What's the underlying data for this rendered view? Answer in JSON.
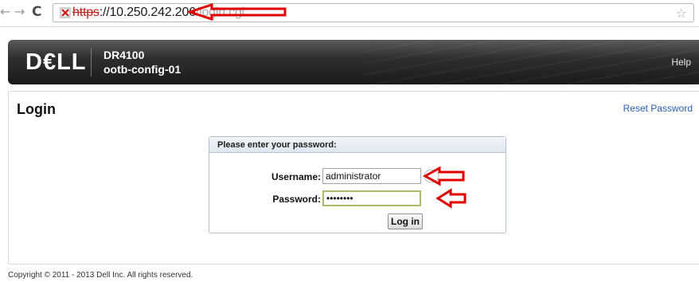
{
  "browser": {
    "url_scheme": "https",
    "url_host": "://10.250.242.206",
    "url_path": "/login.cgi",
    "icons": {
      "back": "arrow-left-icon",
      "forward": "arrow-right-icon",
      "reload": "reload-icon",
      "security": "broken-lock-icon",
      "bookmark": "star-icon"
    }
  },
  "header": {
    "logo": "D€LL",
    "product": "DR4100",
    "host": "ootb-config-01",
    "help": "Help"
  },
  "page": {
    "title": "Login",
    "reset_password": "Reset Password"
  },
  "login_box": {
    "heading": "Please enter your password:",
    "username_label": "Username:",
    "username_value": "administrator",
    "password_label": "Password:",
    "password_value": "••••••••",
    "submit": "Log in"
  },
  "footer": {
    "copyright": "Copyright © 2011 - 2013 Dell Inc. All rights reserved."
  },
  "colors": {
    "annotation": "#e00000",
    "link": "#2a5db0",
    "header_dark": "#1a1a1a"
  }
}
